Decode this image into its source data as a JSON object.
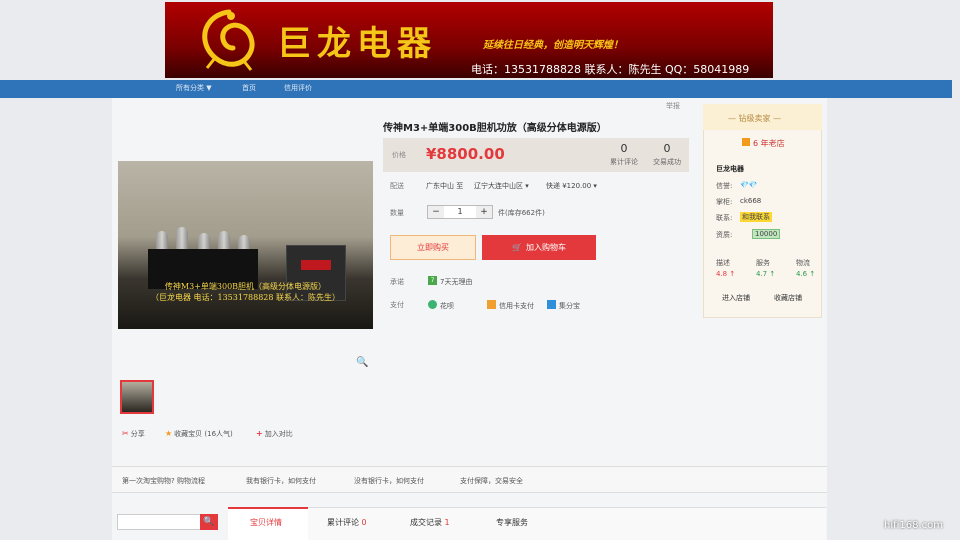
{
  "banner": {
    "shop_name": "巨龙电器",
    "slogan": "延续往日经典，创造明天辉煌！",
    "contact_line": "电话：13531788828   联系人：陈先生   QQ：58041989"
  },
  "nav": {
    "items": [
      "所有分类 ▼",
      "首页",
      "信用评价"
    ]
  },
  "report_link": "举报",
  "product": {
    "title": "传神M3+单端300B胆机功放（高级分体电源版）",
    "photo_caption": "传神M3+单端300B胆机（高级分体电源版）\n（巨龙电器 电话：13531788828 联系人：陈先生）",
    "price_label": "价格",
    "price": "¥8800.00",
    "reviews_count": "0",
    "reviews_label": "累计评论",
    "deals_count": "0",
    "deals_label": "交易成功",
    "ship_label": "配送",
    "ship_from": "广东中山 至",
    "ship_to": "辽宁大连中山区 ▾",
    "ship_fee": "快递 ¥120.00 ▾",
    "qty_label": "数量",
    "qty_minus": "−",
    "qty_value": "1",
    "qty_plus": "+",
    "stock_text": "件(库存662件)",
    "buy_now": "立即购买",
    "add_to_cart": "加入购物车",
    "promise_label": "承诺",
    "promise_badge": "7",
    "promise_text": "7天无理由",
    "pay_label": "支付",
    "pay_methods": [
      "花呗",
      "信用卡支付",
      "集分宝"
    ]
  },
  "actions": {
    "share": "分享",
    "favorite": "收藏宝贝 (16人气)",
    "compare": "加入对比"
  },
  "seller": {
    "level": "— 钻级卖家 —",
    "years": "6 年老店",
    "shop_title": "巨龙电器",
    "rows": [
      {
        "label": "信誉:",
        "value": "💎💎"
      },
      {
        "label": "掌柜:",
        "value": "ck668"
      },
      {
        "label": "联系:",
        "value": "和我联系"
      },
      {
        "label": "资质:",
        "value": "10000"
      }
    ],
    "scores": [
      {
        "label": "描述",
        "value": "4.8 ↑"
      },
      {
        "label": "服务",
        "value": "4.7 ↑"
      },
      {
        "label": "物流",
        "value": "4.6 ↑"
      }
    ],
    "enter_shop": "进入店铺",
    "favorite_shop": "收藏店铺"
  },
  "help": {
    "items": [
      "第一次淘宝购物? 购物流程",
      "我有银行卡，如何支付",
      "没有银行卡，如何支付",
      "支付保障，交易安全"
    ]
  },
  "tabs": {
    "detail": "宝贝详情",
    "reviews": "累计评论",
    "reviews_count": "0",
    "records": "成交记录",
    "records_count": "1",
    "service": "专享服务"
  },
  "watermark": "hifi168.com",
  "colors": {
    "accent": "#e4393c",
    "nav": "#2f73b8",
    "banner_gold": "#f5c518"
  }
}
